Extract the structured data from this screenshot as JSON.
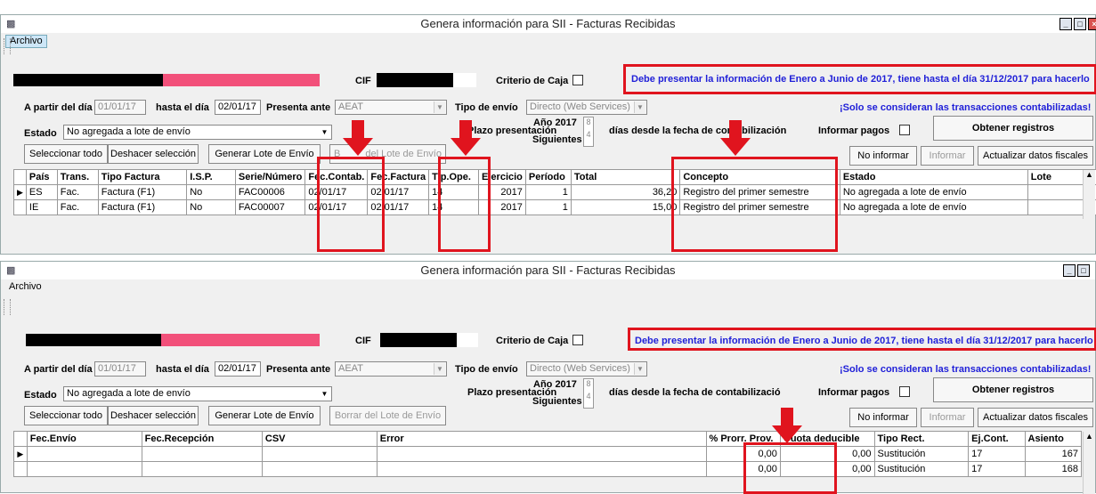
{
  "window_title": "Genera información para SII - Facturas Recibidas",
  "menu": {
    "archivo": "Archivo"
  },
  "form": {
    "cif_label": "CIF",
    "criterio_label": "Criterio de Caja",
    "notice": "Debe presentar la información de Enero a Junio de 2017, tiene hasta el día 31/12/2017 para hacerlo",
    "a_partir_label": "A partir del día",
    "a_partir_value": "01/01/17",
    "hasta_label": "hasta el día",
    "hasta_value": "02/01/17",
    "presenta_label": "Presenta ante",
    "presenta_value": "AEAT",
    "tipo_envio_label": "Tipo de envío",
    "tipo_envio_value": "Directo (Web Services)",
    "solo_notice": "¡Solo se consideran las transacciones contabilizadas!",
    "estado_label": "Estado",
    "estado_value": "No agregada a lote de envío",
    "plazo_label": "Plazo presentación",
    "anio_label": "Año 2017",
    "siguientes_label": "Siguientes",
    "plazo_anio": "8",
    "plazo_sig": "4",
    "dias_label": "días desde la fecha de contabilización",
    "dias_label_cut": "días desde la fecha de contabilizació",
    "informar_pagos_label": "Informar pagos",
    "obtener_label": "Obtener registros"
  },
  "buttons": {
    "seleccionar": "Seleccionar todo",
    "deshacer": "Deshacer selección",
    "generar": "Generar Lote de Envío",
    "borrar": "Borrar del Lote de Envío",
    "borrar_cut_a": "B",
    "borrar_cut_b": "del Lote de Envío",
    "no_informar": "No informar",
    "informar": "Informar",
    "actualizar": "Actualizar datos fiscales"
  },
  "grid1": {
    "headers": [
      "País",
      "Trans.",
      "Tipo Factura",
      "I.S.P.",
      "Serie/Número",
      "Fec.Contab.",
      "Fec.Factura",
      "Tip.Ope.",
      "Ejercicio",
      "Período",
      "Total",
      "Concepto",
      "Estado",
      "Lote"
    ],
    "rows": [
      [
        "ES",
        "Fac.",
        "Factura (F1)",
        "No",
        "FAC00006",
        "02/01/17",
        "02/01/17",
        "14",
        "2017",
        "1",
        "36,20",
        "Registro del primer semestre",
        "No agregada a lote de envío",
        ""
      ],
      [
        "IE",
        "Fac.",
        "Factura (F1)",
        "No",
        "FAC00007",
        "02/01/17",
        "02/01/17",
        "14",
        "2017",
        "1",
        "15,00",
        "Registro del primer semestre",
        "No agregada a lote de envío",
        ""
      ]
    ]
  },
  "grid2": {
    "headers": [
      "Fec.Envío",
      "Fec.Recepción",
      "CSV",
      "Error",
      "% Prorr. Prov.",
      "Cuota deducible",
      "Tipo Rect.",
      "Ej.Cont.",
      "Asiento"
    ],
    "rows": [
      [
        "",
        "",
        "",
        "",
        "0,00",
        "0,00",
        "Sustitución",
        "17",
        "167"
      ],
      [
        "",
        "",
        "",
        "",
        "0,00",
        "0,00",
        "Sustitución",
        "17",
        "168"
      ]
    ]
  },
  "colors": {
    "highlight_red": "#e0141e",
    "notice_blue": "#1f1fd8",
    "redacted_pink": "#f2507a"
  }
}
